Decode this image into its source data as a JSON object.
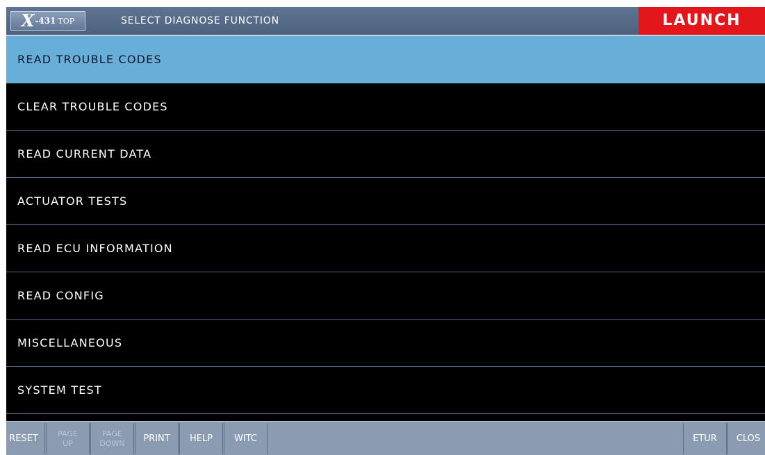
{
  "header": {
    "logo": {
      "x": "X",
      "model": "-431",
      "suffix": "TOP"
    },
    "title": "SELECT DIAGNOSE FUNCTION",
    "brand": "LAUNCH"
  },
  "menu": {
    "selected_index": 0,
    "items": [
      "READ TROUBLE CODES",
      "CLEAR TROUBLE CODES",
      "READ CURRENT DATA",
      "ACTUATOR TESTS",
      "READ ECU INFORMATION",
      "READ CONFIG",
      "MISCELLANEOUS",
      "SYSTEM TEST"
    ]
  },
  "footer": {
    "reset": "RESET",
    "page_up": {
      "line1": "PAGE",
      "line2": "UP"
    },
    "page_down": {
      "line1": "PAGE",
      "line2": "DOWN"
    },
    "print": "PRINT",
    "help": "HELP",
    "switch": "WITC",
    "return": "ETUR",
    "close": "CLOS"
  },
  "colors": {
    "header_bg": "#5e7492",
    "brand_red": "#e3161b",
    "selected_row": "#67afd9",
    "row_bg": "#000000",
    "footer_bg": "#8a9bb2"
  }
}
